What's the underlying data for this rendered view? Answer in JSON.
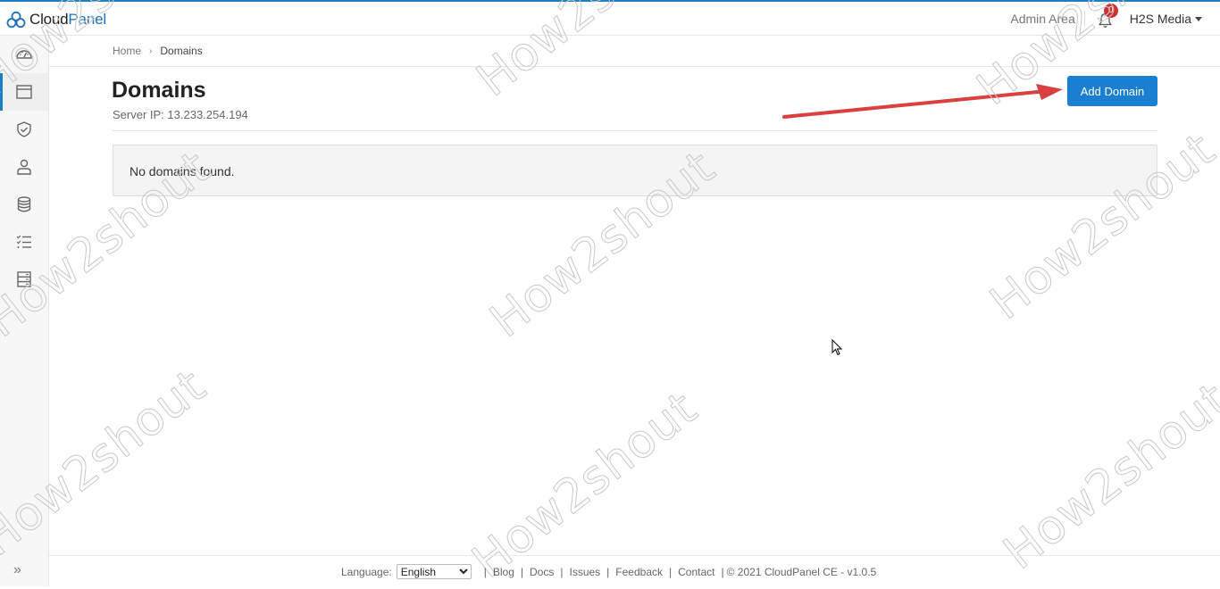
{
  "app": {
    "logo_part1": "Cloud",
    "logo_part2": "Panel",
    "brand_color": "#1c7fc3"
  },
  "topnav": {
    "admin_area": "Admin Area",
    "notifications_icon": "bell-icon",
    "notification_count": "0",
    "user_name": "H2S Media"
  },
  "sidebar": {
    "items": [
      {
        "icon": "dashboard-gauge-icon",
        "active": false
      },
      {
        "icon": "browser-window-icon",
        "active": true
      },
      {
        "icon": "shield-check-icon",
        "active": false
      },
      {
        "icon": "user-icon",
        "active": false
      },
      {
        "icon": "database-icon",
        "active": false
      },
      {
        "icon": "checklist-icon",
        "active": false
      },
      {
        "icon": "server-icon",
        "active": false
      }
    ],
    "collapse_glyph": "»"
  },
  "breadcrumb": {
    "home": "Home",
    "separator": "›",
    "current": "Domains"
  },
  "page": {
    "title": "Domains",
    "server_ip": "Server IP: 13.233.254.194",
    "add_button": "Add Domain",
    "empty_message": "No domains found."
  },
  "footer": {
    "language_label": "Language:",
    "language_selected": "English",
    "links": [
      "Blog",
      "Docs",
      "Issues",
      "Feedback",
      "Contact"
    ],
    "copyright": "© 2021 CloudPanel CE - v1.0.5"
  },
  "watermark": "How2shout",
  "annotation_color": "#d9403f"
}
